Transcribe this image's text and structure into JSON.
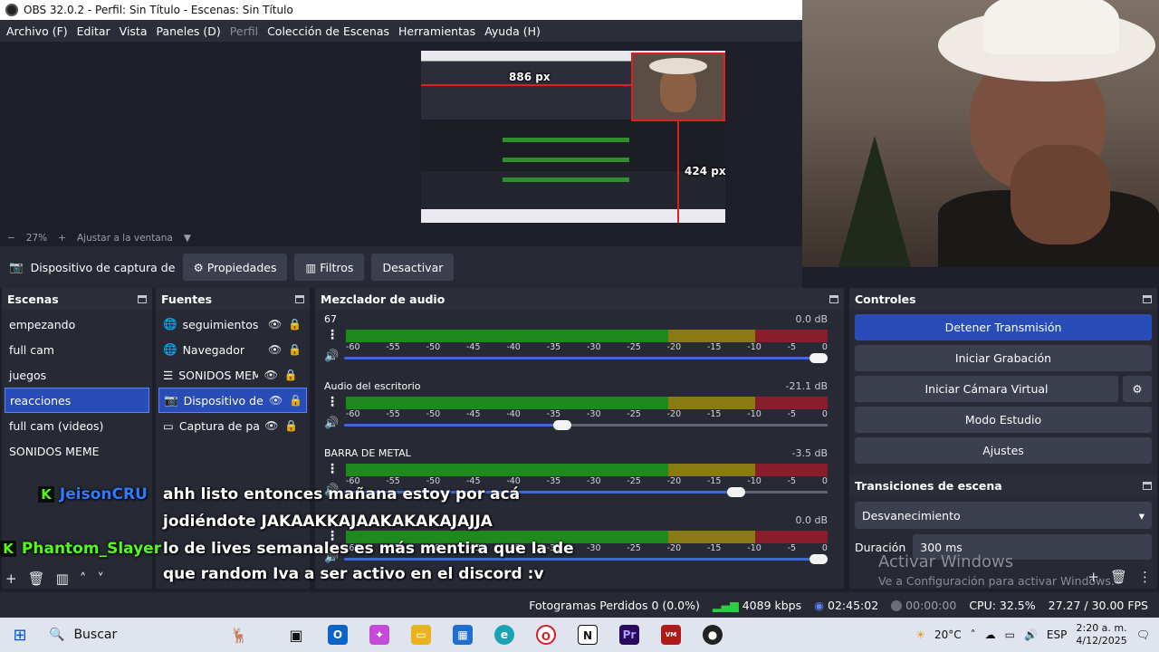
{
  "window": {
    "title": "OBS 32.0.2 - Perfil: Sin Título - Escenas: Sin Título"
  },
  "menu": [
    {
      "label": "Archivo (F)",
      "enabled": true
    },
    {
      "label": "Editar",
      "enabled": true
    },
    {
      "label": "Vista",
      "enabled": true
    },
    {
      "label": "Paneles (D)",
      "enabled": true
    },
    {
      "label": "Perfil",
      "enabled": false
    },
    {
      "label": "Colección de Escenas",
      "enabled": true
    },
    {
      "label": "Herramientas",
      "enabled": true
    },
    {
      "label": "Ayuda (H)",
      "enabled": true
    }
  ],
  "preview": {
    "label_horizontal": "886 px",
    "label_vertical": "424 px",
    "zoom_minus": "−",
    "zoom_value": "27%",
    "zoom_plus": "+",
    "zoom_fit": "Ajustar a la ventana",
    "zoom_dropdown": "▼"
  },
  "source_toolbar": {
    "current_source": "Dispositivo de captura de v",
    "properties": "Propiedades",
    "filters": "Filtros",
    "deactivate": "Desactivar"
  },
  "scenes": {
    "title": "Escenas",
    "items": [
      "empezando",
      "full cam",
      "juegos",
      "reacciones",
      "full cam (videos)",
      "SONIDOS MEME"
    ],
    "selected_index": 3
  },
  "sources": {
    "title": "Fuentes",
    "items": [
      {
        "name": "seguimientos",
        "icon": "globe-icon"
      },
      {
        "name": "Navegador",
        "icon": "globe-icon"
      },
      {
        "name": "SONIDOS MEM",
        "icon": "list-icon"
      },
      {
        "name": "Dispositivo de c",
        "icon": "camera-icon"
      },
      {
        "name": "Captura de pan",
        "icon": "monitor-icon"
      }
    ],
    "selected_index": 3
  },
  "mixer": {
    "title": "Mezclador de audio",
    "ticks": [
      "-60",
      "-55",
      "-50",
      "-45",
      "-40",
      "-35",
      "-30",
      "-25",
      "-20",
      "-15",
      "-10",
      "-5",
      "0"
    ],
    "channels": [
      {
        "name": "67",
        "db": "0.0 dB",
        "volume": 1.0
      },
      {
        "name": "Audio del escritorio",
        "db": "-21.1 dB",
        "volume": 0.47
      },
      {
        "name": "BARRA DE METAL",
        "db": "-3.5 dB",
        "volume": 0.83
      },
      {
        "name": "",
        "db": "0.0 dB",
        "volume": 1.0
      }
    ]
  },
  "controls": {
    "title": "Controles",
    "stop_stream": "Detener Transmisión",
    "start_recording": "Iniciar Grabación",
    "virtual_camera": "Iniciar Cámara Virtual",
    "studio_mode": "Modo Estudio",
    "settings": "Ajustes"
  },
  "transitions": {
    "title": "Transiciones de escena",
    "selected": "Desvanecimiento",
    "duration_label": "Duración",
    "duration_value": "300 ms"
  },
  "watermark": {
    "line1": "Activar Windows",
    "line2": "Ve a Configuración para activar Windows."
  },
  "chat": [
    {
      "user": "JeisonCRU",
      "user_color": "#2f7bff",
      "text": [
        "ahh listo entonces mañana estoy por acá",
        "jodiéndote JAKAAKKAJAAKAKAKAJAJJA"
      ]
    },
    {
      "user": "Phantom_Slayer",
      "user_color": "#53fc18",
      "text": [
        "lo de lives semanales es más mentira que la de",
        "que random Iva a ser activo en el discord :v"
      ]
    }
  ],
  "status": {
    "dropped_frames": "Fotogramas Perdidos 0 (0.0%)",
    "bitrate": "4089 kbps",
    "stream_time": "02:45:02",
    "rec_time": "00:00:00",
    "cpu": "CPU: 32.5%",
    "fps": "27.27 / 30.00 FPS"
  },
  "taskbar": {
    "search_placeholder": "Buscar",
    "weather": "20°C",
    "language": "ESP",
    "time": "2:20 a. m.",
    "date": "4/12/2025"
  },
  "colors": {
    "accent": "#284cb8",
    "panel": "#272935",
    "background": "#1e1f29",
    "meter_green": "#1e8a1e",
    "meter_yellow": "#8a7a13",
    "meter_red": "#8a1d2b"
  }
}
